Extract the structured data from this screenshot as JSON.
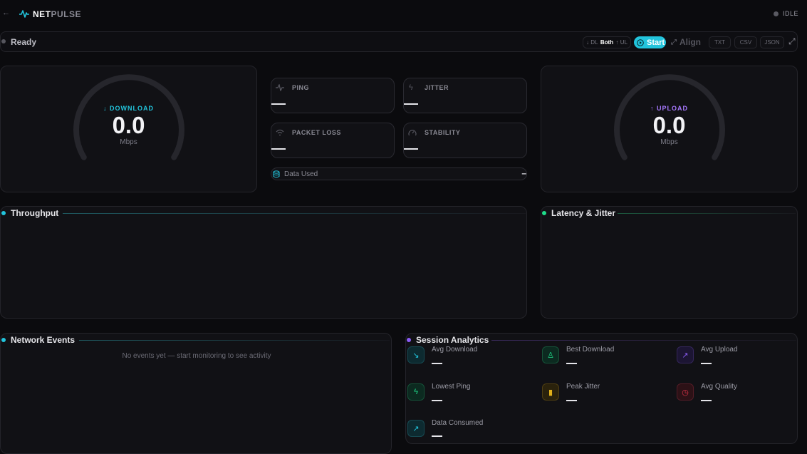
{
  "header": {
    "back_icon": "arrow-left-icon",
    "logo_icon": "pulse-icon",
    "brand_part1": "NET",
    "brand_part2": "PULSE",
    "status": "IDLE",
    "status_color": "#5a5a62"
  },
  "toolbar": {
    "status_text": "Ready",
    "mode_dl": "↓ DL",
    "mode_both": "Both",
    "mode_ul": "↑ UL",
    "start_label": "Start",
    "align_label": "Align",
    "txt_label": "TXT",
    "csv_label": "CSV",
    "json_label": "JSON",
    "accent": "#22c4dc"
  },
  "download": {
    "label": "DOWNLOAD",
    "arrow": "↓",
    "value": "0.0",
    "unit": "Mbps",
    "color": "#22c4dc"
  },
  "upload": {
    "label": "UPLOAD",
    "arrow": "↑",
    "value": "0.0",
    "unit": "Mbps",
    "color": "#a779ff"
  },
  "metrics": {
    "ping": {
      "label": "PING",
      "icon": "activity-icon"
    },
    "jitter": {
      "label": "JITTER",
      "icon": "zap-icon"
    },
    "packet_loss": {
      "label": "PACKET LOSS",
      "icon": "wifi-icon"
    },
    "stability": {
      "label": "STABILITY",
      "icon": "gauge-icon"
    },
    "data_used": {
      "label": "Data Used",
      "value": "–",
      "icon": "database-icon"
    }
  },
  "throughput": {
    "title": "Throughput",
    "color": "#22c4dc"
  },
  "latency": {
    "title": "Latency & Jitter",
    "color": "#1fdc8a"
  },
  "events": {
    "title": "Network Events",
    "empty": "No events yet — start monitoring to see activity",
    "color": "#22c4dc"
  },
  "analytics": {
    "title": "Session Analytics",
    "color": "#8b5cf6",
    "items": [
      {
        "label": "Avg Download",
        "icon": "trending-down-icon",
        "color": "#22c4dc"
      },
      {
        "label": "Best Download",
        "icon": "award-icon",
        "color": "#1fdc8a"
      },
      {
        "label": "Avg Upload",
        "icon": "trending-up-icon",
        "color": "#8b5cf6"
      },
      {
        "label": "Lowest Ping",
        "icon": "zap-icon",
        "color": "#1fdc8a"
      },
      {
        "label": "Peak Jitter",
        "icon": "bar-chart-icon",
        "color": "#e0b01a"
      },
      {
        "label": "Avg Quality",
        "icon": "clock-icon",
        "color": "#e0344a"
      },
      {
        "label": "Data Consumed",
        "icon": "trending-up-icon",
        "color": "#22c4dc"
      }
    ]
  }
}
